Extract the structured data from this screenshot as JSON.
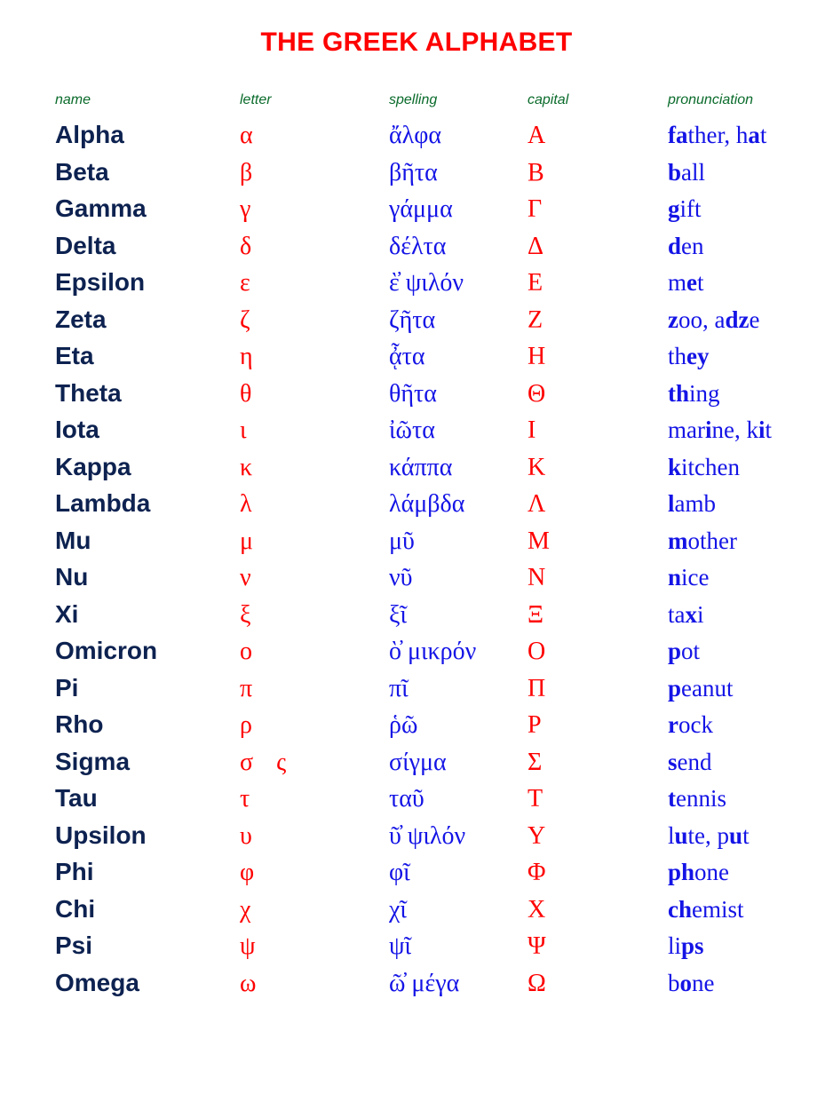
{
  "document": {
    "title": "THE GREEK ALPHABET",
    "title_color": "#fe0000",
    "header_color": "#0a6b2b",
    "name_color": "#0d2250",
    "greek_letter_color": "#fe0000",
    "spelling_color": "#1414e6",
    "pronunciation_color": "#1414e6",
    "background_color": "#ffffff"
  },
  "table": {
    "columns": [
      {
        "key": "name",
        "label": "name"
      },
      {
        "key": "letter",
        "label": "letter"
      },
      {
        "key": "spelling",
        "label": "spelling"
      },
      {
        "key": "capital",
        "label": "capital"
      },
      {
        "key": "pronunciation",
        "label": "pronunciation"
      }
    ],
    "rows": [
      {
        "name": "Alpha",
        "letter": "α",
        "letter_alt": "",
        "spelling": "ἄλφα",
        "capital": "Α",
        "pronunciation_html": "<b>fa</b>ther, h<b>a</b>t",
        "pronunciation_text": "father, hat"
      },
      {
        "name": "Beta",
        "letter": "β",
        "letter_alt": "",
        "spelling": "βῆτα",
        "capital": "Β",
        "pronunciation_html": "<b>b</b>all",
        "pronunciation_text": "ball"
      },
      {
        "name": "Gamma",
        "letter": "γ",
        "letter_alt": "",
        "spelling": "γάμμα",
        "capital": "Γ",
        "pronunciation_html": "<b>g</b>ift",
        "pronunciation_text": "gift"
      },
      {
        "name": "Delta",
        "letter": "δ",
        "letter_alt": "",
        "spelling": "δέλτα",
        "capital": "Δ",
        "pronunciation_html": "<b>d</b>en",
        "pronunciation_text": "den"
      },
      {
        "name": "Epsilon",
        "letter": "ε",
        "letter_alt": "",
        "spelling": "ὲ̓ ψιλόν",
        "capital": "Ε",
        "pronunciation_html": "m<b>e</b>t",
        "pronunciation_text": "met"
      },
      {
        "name": "Zeta",
        "letter": "ζ",
        "letter_alt": "",
        "spelling": "ζῆτα",
        "capital": "Ζ",
        "pronunciation_html": "<b>z</b>oo, a<b>dz</b>e",
        "pronunciation_text": "zoo, adze"
      },
      {
        "name": "Eta",
        "letter": "η",
        "letter_alt": "",
        "spelling": "ᾆτα",
        "capital": "Η",
        "pronunciation_html": "th<b>ey</b>",
        "pronunciation_text": "they"
      },
      {
        "name": "Theta",
        "letter": "θ",
        "letter_alt": "",
        "spelling": "θῆτα",
        "capital": "Θ",
        "pronunciation_html": "<b>th</b>ing",
        "pronunciation_text": "thing"
      },
      {
        "name": "Iota",
        "letter": "ι",
        "letter_alt": "",
        "spelling": "ἰῶτα",
        "capital": "Ι",
        "pronunciation_html": "mar<b>i</b>ne, k<b>i</b>t",
        "pronunciation_text": "marine, kit"
      },
      {
        "name": "Kappa",
        "letter": "κ",
        "letter_alt": "",
        "spelling": "κάππα",
        "capital": "Κ",
        "pronunciation_html": "<b>k</b>itchen",
        "pronunciation_text": "kitchen"
      },
      {
        "name": "Lambda",
        "letter": "λ",
        "letter_alt": "",
        "spelling": "λάμβδα",
        "capital": "Λ",
        "pronunciation_html": "<b>l</b>amb",
        "pronunciation_text": "lamb"
      },
      {
        "name": "Mu",
        "letter": "μ",
        "letter_alt": "",
        "spelling": "μῦ",
        "capital": "Μ",
        "pronunciation_html": "<b>m</b>other",
        "pronunciation_text": "mother"
      },
      {
        "name": "Nu",
        "letter": "ν",
        "letter_alt": "",
        "spelling": "νῦ",
        "capital": "Ν",
        "pronunciation_html": "<b>n</b>ice",
        "pronunciation_text": "nice"
      },
      {
        "name": "Xi",
        "letter": "ξ",
        "letter_alt": "",
        "spelling": "ξῖ",
        "capital": "Ξ",
        "pronunciation_html": "ta<b>x</b>i",
        "pronunciation_text": "taxi"
      },
      {
        "name": "Omicron",
        "letter": "ο",
        "letter_alt": "",
        "spelling": "ὸ̓ μικρόν",
        "capital": "Ο",
        "pronunciation_html": "<b>p</b>ot",
        "pronunciation_text": "pot"
      },
      {
        "name": "Pi",
        "letter": "π",
        "letter_alt": "",
        "spelling": "πῖ",
        "capital": "Π",
        "pronunciation_html": "<b>p</b>eanut",
        "pronunciation_text": "peanut"
      },
      {
        "name": "Rho",
        "letter": "ρ",
        "letter_alt": "",
        "spelling": "ῥῶ",
        "capital": "Ρ",
        "pronunciation_html": "<b>r</b>ock",
        "pronunciation_text": "rock"
      },
      {
        "name": "Sigma",
        "letter": "σ",
        "letter_alt": "ς",
        "spelling": "σίγμα",
        "capital": "Σ",
        "pronunciation_html": "<b>s</b>end",
        "pronunciation_text": "send"
      },
      {
        "name": "Tau",
        "letter": "τ",
        "letter_alt": "",
        "spelling": "ταῦ",
        "capital": "Τ",
        "pronunciation_html": "<b>t</b>ennis",
        "pronunciation_text": "tennis"
      },
      {
        "name": "Upsilon",
        "letter": "υ",
        "letter_alt": "",
        "spelling": "ῦ̓ ψιλόν",
        "capital": "Υ",
        "pronunciation_html": "l<b>u</b>te, p<b>u</b>t",
        "pronunciation_text": "lute, put"
      },
      {
        "name": "Phi",
        "letter": "φ",
        "letter_alt": "",
        "spelling": "φῖ",
        "capital": "Φ",
        "pronunciation_html": "<b>ph</b>one",
        "pronunciation_text": "phone"
      },
      {
        "name": "Chi",
        "letter": "χ",
        "letter_alt": "",
        "spelling": "χῖ",
        "capital": "Χ",
        "pronunciation_html": "<b>ch</b>emist",
        "pronunciation_text": "chemist"
      },
      {
        "name": "Psi",
        "letter": "ψ",
        "letter_alt": "",
        "spelling": "ψῖ",
        "capital": "Ψ",
        "pronunciation_html": "li<b>ps</b>",
        "pronunciation_text": "lips"
      },
      {
        "name": "Omega",
        "letter": "ω",
        "letter_alt": "",
        "spelling": "ῶ̓ μέγα",
        "capital": "Ω",
        "pronunciation_html": "b<b>o</b>ne",
        "pronunciation_text": "bone"
      }
    ]
  }
}
